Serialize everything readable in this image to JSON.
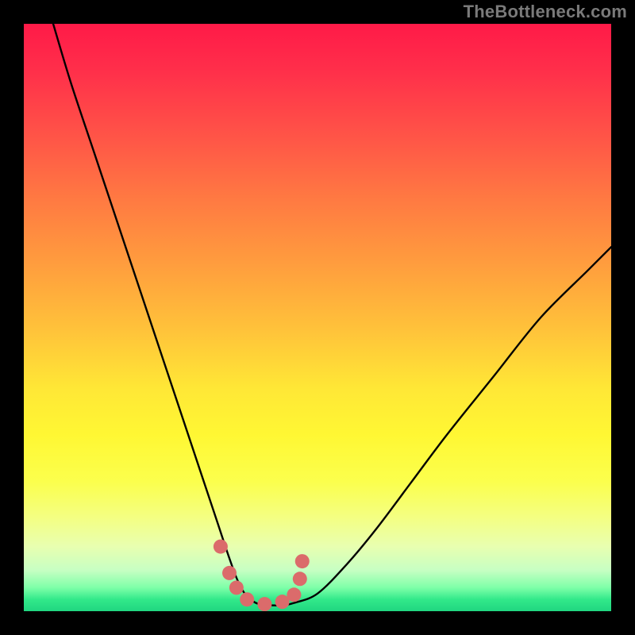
{
  "attribution": "TheBottleneck.com",
  "chart_data": {
    "type": "line",
    "title": "",
    "xlabel": "",
    "ylabel": "",
    "xlim": [
      0,
      100
    ],
    "ylim": [
      0,
      100
    ],
    "series": [
      {
        "name": "bottleneck-curve",
        "x": [
          5,
          8,
          12,
          16,
          20,
          24,
          28,
          31,
          33,
          35,
          36.5,
          38,
          40,
          42,
          44,
          46,
          50,
          55,
          60,
          66,
          72,
          80,
          88,
          96,
          100
        ],
        "y": [
          100,
          90,
          78,
          66,
          54,
          42,
          30,
          21,
          15,
          9,
          5,
          2.5,
          1.2,
          1.0,
          1.0,
          1.4,
          3,
          8,
          14,
          22,
          30,
          40,
          50,
          58,
          62
        ]
      },
      {
        "name": "marker-dots",
        "x": [
          33.5,
          35.0,
          36.2,
          38.0,
          41.0,
          44.0,
          46.0,
          47.0,
          47.4
        ],
        "y": [
          11.0,
          6.5,
          4.0,
          2.0,
          1.2,
          1.6,
          2.8,
          5.5,
          8.5
        ]
      }
    ],
    "colors": {
      "curve": "#000000",
      "markers": "#db6b6b",
      "background_top": "#ff1a48",
      "background_bottom": "#20d680"
    }
  }
}
